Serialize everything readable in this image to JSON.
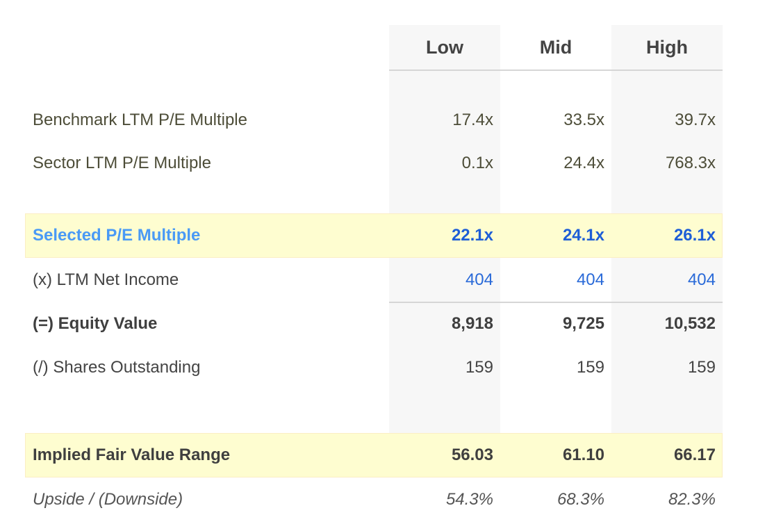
{
  "columns": [
    "Low",
    "Mid",
    "High"
  ],
  "colors": {
    "highlight_bg": "#fefdd0",
    "highlight_label": "#4a9af5",
    "highlight_value": "#1e5ed6",
    "link_value": "#2a6ad8",
    "column_shade": "#f7f7f7"
  },
  "rows": [
    {
      "label": "Benchmark LTM P/E Multiple",
      "values": [
        "17.4x",
        "33.5x",
        "39.7x"
      ]
    },
    {
      "label": "Sector LTM P/E Multiple",
      "values": [
        "0.1x",
        "24.4x",
        "768.3x"
      ]
    },
    {
      "label": "Selected P/E Multiple",
      "values": [
        "22.1x",
        "24.1x",
        "26.1x"
      ]
    },
    {
      "label": "(x) LTM Net Income",
      "values": [
        "404",
        "404",
        "404"
      ]
    },
    {
      "label": "(=) Equity Value",
      "values": [
        "8,918",
        "9,725",
        "10,532"
      ]
    },
    {
      "label": "(/) Shares Outstanding",
      "values": [
        "159",
        "159",
        "159"
      ]
    },
    {
      "label": "Implied Fair Value Range",
      "values": [
        "56.03",
        "61.10",
        "66.17"
      ]
    },
    {
      "label": "Upside / (Downside)",
      "values": [
        "54.3%",
        "68.3%",
        "82.3%"
      ]
    }
  ]
}
